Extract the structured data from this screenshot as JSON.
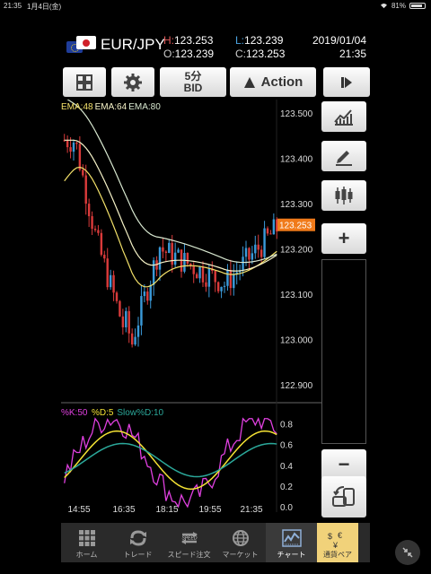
{
  "status": {
    "time": "21:35",
    "date": "1月4日(金)",
    "battery": "81%"
  },
  "header": {
    "pair": "EUR/JPY",
    "high_label": "H:",
    "high": "123.253",
    "low_label": "L:",
    "low": "123.239",
    "open_label": "O:",
    "open": "123.239",
    "close_label": "C:",
    "close": "123.253",
    "date": "2019/01/04",
    "time": "21:35"
  },
  "toolbar": {
    "grid_icon": "grid-icon",
    "settings_icon": "gear-icon",
    "timeframe": "5分",
    "price_side": "BID",
    "action_label": "Action",
    "play_icon": "play-icon"
  },
  "chart": {
    "ema_labels": [
      {
        "text": "EMA:48",
        "color": "#f4e26a"
      },
      {
        "text": "EMA:64",
        "color": "#f6f3c8"
      },
      {
        "text": "EMA:80",
        "color": "#d8e8d0"
      }
    ],
    "price_ticks": [
      "123.500",
      "123.400",
      "123.300",
      "123.253",
      "123.200",
      "123.100",
      "123.000",
      "122.900"
    ],
    "current_price": "123.253",
    "stoch_labels": [
      {
        "text": "%K:50",
        "color": "#e040e0"
      },
      {
        "text": "%D:5",
        "color": "#f4e234"
      },
      {
        "text": "Slow%D:10",
        "color": "#2ba89a"
      }
    ],
    "stoch_ticks": [
      "0.8",
      "0.6",
      "0.4",
      "0.2",
      "0.0"
    ],
    "time_ticks": [
      "14:55",
      "16:35",
      "18:15",
      "19:55",
      "21:35"
    ]
  },
  "chart_data": {
    "type": "candlestick",
    "ylim": [
      122.88,
      123.51
    ],
    "stoch_ylim": [
      0,
      0.9
    ],
    "x": [
      "14:55",
      "16:35",
      "18:15",
      "19:55",
      "21:35"
    ],
    "current_price": 123.253
  },
  "side": {
    "line_icon": "line-chart-icon",
    "draw_icon": "pencil-icon",
    "candle_icon": "candlestick-icon",
    "zoom_in": "+",
    "zoom_out": "−",
    "rotate_icon": "rotate-device-icon"
  },
  "nav": {
    "items": [
      {
        "label": "ホーム",
        "icon": "home-grid-icon"
      },
      {
        "label": "トレード",
        "icon": "trade-arrows-icon"
      },
      {
        "label": "スピード注文",
        "icon": "speed-icon"
      },
      {
        "label": "マーケット",
        "icon": "globe-icon"
      },
      {
        "label": "チャート",
        "icon": "chart-icon"
      }
    ],
    "pair_label": "通貨ペア"
  }
}
